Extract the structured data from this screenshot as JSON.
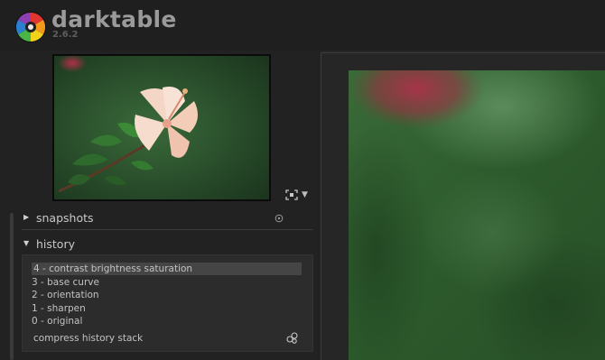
{
  "app": {
    "title": "darktable",
    "version": "2.6.2"
  },
  "navigation": {
    "zoom_icon": "fit-zoom-icon",
    "dropdown_icon": "chevron-down-icon"
  },
  "modules": {
    "snapshots": {
      "label": "snapshots",
      "expanded": false
    },
    "history": {
      "label": "history",
      "expanded": true,
      "items": [
        "4 - contrast brightness saturation",
        "3 - base curve",
        "2 - orientation",
        "1 - sharpen",
        "0 - original"
      ],
      "selected_index": 0,
      "compress_label": "compress history stack"
    }
  },
  "colors": {
    "background": "#1e1e1e",
    "panel": "#222222",
    "history_bg": "#2c2c2c",
    "selected_row": "#454545"
  }
}
